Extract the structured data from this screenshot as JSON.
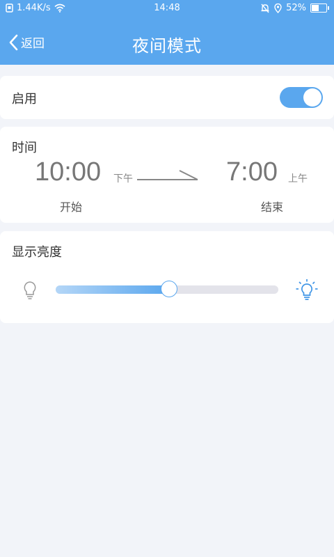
{
  "status_bar": {
    "network_speed": "1.44K/s",
    "time": "14:48",
    "battery": "52%",
    "battery_level": 0.52
  },
  "nav": {
    "back_label": "返回",
    "title": "夜间模式"
  },
  "enable": {
    "label": "启用",
    "enabled": true
  },
  "time_section": {
    "label": "时间",
    "start": {
      "time": "10:00",
      "ampm": "下午",
      "caption": "开始"
    },
    "end": {
      "time": "7:00",
      "ampm": "上午",
      "caption": "结束"
    }
  },
  "brightness": {
    "label": "显示亮度",
    "level": 0.51
  },
  "colors": {
    "accent": "#5aa7ee",
    "background": "#f2f4f9",
    "text": "#333333"
  }
}
